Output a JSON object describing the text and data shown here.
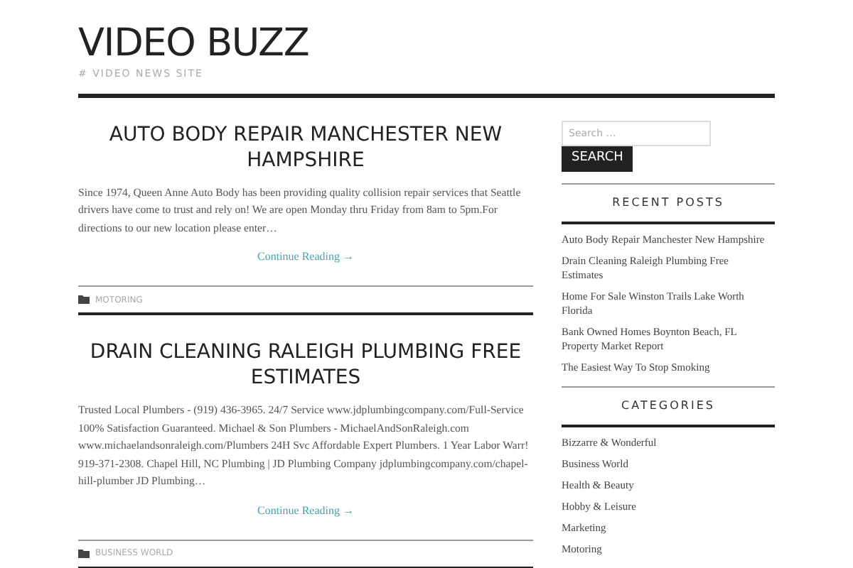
{
  "site": {
    "title": "VIDEO BUZZ",
    "tagline": "# VIDEO NEWS SITE"
  },
  "posts": [
    {
      "title": "AUTO BODY REPAIR MANCHESTER NEW HAMPSHIRE",
      "excerpt": "Since 1974, Queen Anne Auto Body has been providing quality collision repair services that Seattle drivers have come to trust and rely on! We are open Monday thru Friday from 8am to 5pm.For directions to our new location please enter…",
      "more": "Continue Reading →",
      "category": "MOTORING"
    },
    {
      "title": "DRAIN CLEANING RALEIGH PLUMBING FREE ESTIMATES",
      "excerpt": "Trusted Local Plumbers - (919) 436-3965. 24/7 Service www.jdplumbingcompany.com/Full-Service 100% Satisfaction Guaranteed. Michael & Son Plumbers - MichaelAndSonRaleigh.com www.michaelandsonraleigh.com/Plumbers 24H Svc Affordable Expert Plumbers. 1 Year Labor Warr! 919-371-2308. Chapel Hill, NC Plumbing | JD Plumbing Company jdplumbingcompany.com/chapel-hill-plumber JD Plumbing…",
      "more": "Continue Reading →",
      "category": "BUSINESS WORLD"
    }
  ],
  "sidebar": {
    "search": {
      "placeholder": "Search …",
      "button": "SEARCH"
    },
    "widgets": [
      {
        "title": "RECENT POSTS",
        "items": [
          "Auto Body Repair Manchester New Hampshire",
          "Drain Cleaning Raleigh Plumbing Free Estimates",
          "Home For Sale Winston Trails Lake Worth Florida",
          "Bank Owned Homes Boynton Beach, FL Property Market Report",
          "The Easiest Way To Stop Smoking"
        ]
      },
      {
        "title": "CATEGORIES",
        "items": [
          "Bizzarre & Wonderful",
          "Business World",
          "Health & Beauty",
          "Hobby & Leisure",
          "Marketing",
          "Motoring"
        ]
      }
    ]
  }
}
